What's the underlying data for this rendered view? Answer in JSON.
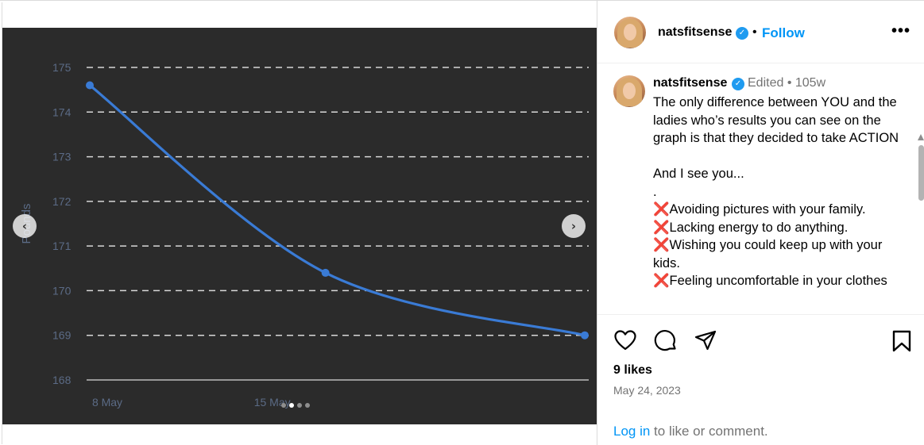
{
  "post": {
    "username": "natsfitsense",
    "follow_label": "Follow",
    "separator": "•",
    "more_label": "•••",
    "edited_label": "Edited •",
    "age": "105w",
    "caption": "The only difference between YOU and the ladies who’s results you can see on the graph is that they decided to take ACTION\n\nAnd I see you...\n.\n❌Avoiding pictures with your family.\n❌Lacking energy to do anything.\n❌Wishing you could keep up with your kids.\n❌Feeling uncomfortable in your clothes",
    "likes": "9 likes",
    "date": "May 24, 2023",
    "login_link": "Log in",
    "login_rest": " to like or comment."
  },
  "carousel": {
    "prev_icon": "‹",
    "next_icon": "›",
    "slide_count": 4,
    "active_slide": 2
  },
  "colors": {
    "chart_bg": "#2b2b2b",
    "line": "#3a7bd5",
    "axis_text": "#5b6b86",
    "accent": "#0095f6",
    "verified": "#1f9bf0"
  },
  "chart_data": {
    "type": "line",
    "title": "",
    "xlabel": "",
    "ylabel": "Pounds",
    "x_ticks": [
      "8 May",
      "15 May"
    ],
    "y_ticks": [
      175,
      174,
      173,
      172,
      171,
      170,
      169,
      168
    ],
    "ylim": [
      168,
      175
    ],
    "grid": "dashed horizontal",
    "series": [
      {
        "points": [
          {
            "x": "8 May",
            "y": 174.6
          },
          {
            "x": "18 May",
            "y": 170.4
          },
          {
            "x": "29 May",
            "y": 169.0
          }
        ]
      }
    ]
  }
}
